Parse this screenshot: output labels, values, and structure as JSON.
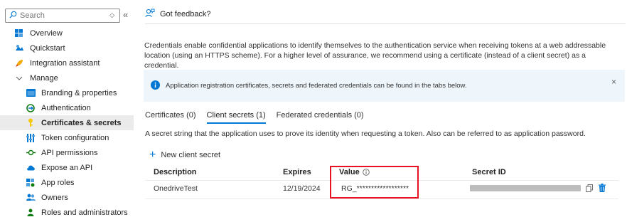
{
  "sidebar": {
    "search_placeholder": "Search",
    "collapse_glyph": "«",
    "items": [
      {
        "label": "Overview",
        "icon": "overview-icon"
      },
      {
        "label": "Quickstart",
        "icon": "quickstart-icon"
      },
      {
        "label": "Integration assistant",
        "icon": "rocket-icon"
      },
      {
        "label": "Manage",
        "icon": "chevron-down-icon"
      },
      {
        "label": "Branding & properties",
        "icon": "branding-icon"
      },
      {
        "label": "Authentication",
        "icon": "authentication-icon"
      },
      {
        "label": "Certificates & secrets",
        "icon": "key-icon"
      },
      {
        "label": "Token configuration",
        "icon": "token-icon"
      },
      {
        "label": "API permissions",
        "icon": "api-permissions-icon"
      },
      {
        "label": "Expose an API",
        "icon": "cloud-icon"
      },
      {
        "label": "App roles",
        "icon": "app-roles-icon"
      },
      {
        "label": "Owners",
        "icon": "owners-icon"
      },
      {
        "label": "Roles and administrators",
        "icon": "roles-icon"
      }
    ]
  },
  "main": {
    "feedback_label": "Got feedback?",
    "description": "Credentials enable confidential applications to identify themselves to the authentication service when receiving tokens at a web addressable location (using an HTTPS scheme). For a higher level of assurance, we recommend using a certificate (instead of a client secret) as a credential.",
    "info_text": "Application registration certificates, secrets and federated credentials can be found in the tabs below.",
    "info_close": "×",
    "tabs": [
      {
        "label": "Certificates (0)"
      },
      {
        "label": "Client secrets (1)"
      },
      {
        "label": "Federated credentials (0)"
      }
    ],
    "secret_description": "A secret string that the application uses to prove its identity when requesting a token. Also can be referred to as application password.",
    "new_secret_label": "New client secret",
    "table": {
      "headers": [
        "Description",
        "Expires",
        "Value",
        "Secret ID"
      ],
      "rows": [
        {
          "description": "OnedriveTest",
          "expires": "12/19/2024",
          "value": "RG_******************"
        }
      ]
    }
  },
  "colors": {
    "accent": "#0078d4",
    "highlight_border": "#e81123",
    "info_bg": "#eef6fc",
    "selected_bg": "#ebebeb"
  }
}
